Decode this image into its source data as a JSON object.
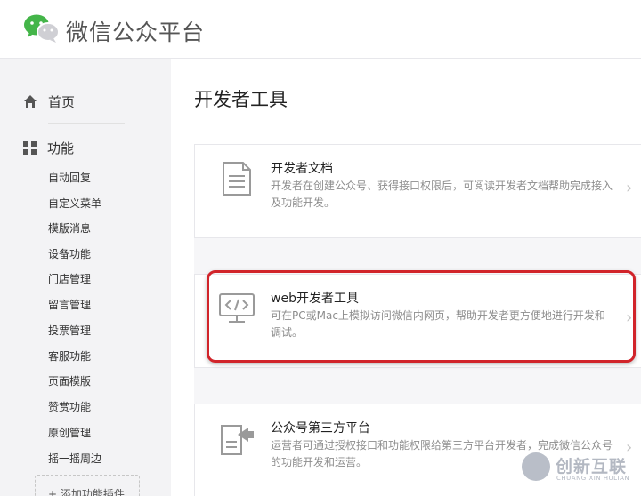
{
  "header": {
    "brand": "微信公众平台",
    "logo_icon": "wechat-logo-icon",
    "accent_color": "#44b549"
  },
  "sidebar": {
    "home": {
      "icon": "home-icon",
      "label": "首页"
    },
    "features": {
      "icon": "grid-icon",
      "label": "功能",
      "items": [
        "自动回复",
        "自定义菜单",
        "模版消息",
        "设备功能",
        "门店管理",
        "留言管理",
        "投票管理",
        "客服功能",
        "页面模版",
        "赞赏功能",
        "原创管理",
        "摇一摇周边"
      ]
    },
    "add_plugin": "+ 添加功能插件"
  },
  "main": {
    "title": "开发者工具",
    "cards": [
      {
        "icon": "document-icon",
        "title": "开发者文档",
        "desc": "开发者在创建公众号、获得接口权限后，可阅读开发者文档帮助完成接入及功能开发。"
      },
      {
        "icon": "code-monitor-icon",
        "title": "web开发者工具",
        "desc": "可在PC或Mac上模拟访问微信内网页，帮助开发者更方便地进行开发和调试。"
      },
      {
        "icon": "third-party-icon",
        "title": "公众号第三方平台",
        "desc": "运营者可通过授权接口和功能权限给第三方平台开发者，完成微信公众号的功能开发和运营。"
      }
    ],
    "highlight_color": "#d1242a"
  },
  "watermark": {
    "text": "创新互联",
    "sub": "CHUANG XIN HULIAN"
  }
}
